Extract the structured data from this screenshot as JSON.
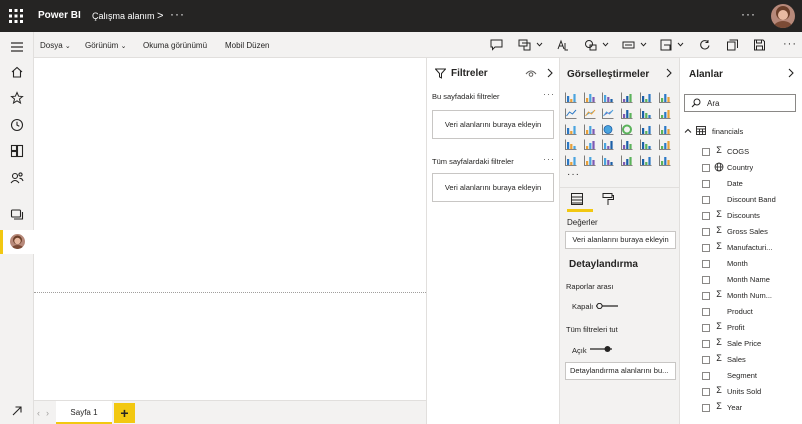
{
  "colors": {
    "topbar": "#252423",
    "accent_yellow": "#f2c811",
    "rail_bg": "#f3f2f1"
  },
  "topbar": {
    "app_name": "Power BI",
    "workspace": "Çalışma alanım",
    "chevron": ">",
    "more": "···",
    "right_more": "···"
  },
  "menu": {
    "items": [
      "Dosya",
      "Görünüm",
      "Okuma görünümü",
      "Mobil Düzen"
    ]
  },
  "toolbar": {
    "icons": [
      "comment-icon",
      "visual-interactions-icon",
      "text-box-icon",
      "shapes-icon",
      "buttons-icon",
      "image-icon",
      "refresh-icon",
      "duplicate-icon",
      "save-icon",
      "more-icon"
    ],
    "more": "···"
  },
  "filters": {
    "title": "Filtreler",
    "this_page_label": "Bu sayfadaki filtreler",
    "this_page_drop": "Veri alanlarını buraya ekleyin",
    "all_pages_label": "Tüm sayfalardaki filtreler",
    "all_pages_drop": "Veri alanlarını buraya ekleyin",
    "more": "···"
  },
  "visualizations": {
    "title": "Görselleştirmeler",
    "more": "···",
    "values_label": "Değerler",
    "values_drop": "Veri alanlarını buraya ekleyin",
    "drillthrough_title": "Detaylandırma",
    "cross_report_label": "Raporlar arası",
    "cross_report_state": "Kapalı",
    "cross_report_on": false,
    "keep_filters_label": "Tüm filtreleri tut",
    "keep_filters_state": "Açık",
    "keep_filters_on": true,
    "drillthrough_drop": "Detaylandırma alanlarını bu..."
  },
  "fields": {
    "title": "Alanlar",
    "search_placeholder": "Ara",
    "table_name": "financials",
    "items": [
      {
        "name": "COGS",
        "icon": "sigma"
      },
      {
        "name": "Country",
        "icon": "globe"
      },
      {
        "name": "Date",
        "icon": "none"
      },
      {
        "name": "Discount Band",
        "icon": "none"
      },
      {
        "name": "Discounts",
        "icon": "sigma"
      },
      {
        "name": "Gross Sales",
        "icon": "sigma"
      },
      {
        "name": "Manufacturi...",
        "icon": "sigma"
      },
      {
        "name": "Month",
        "icon": "none"
      },
      {
        "name": "Month Name",
        "icon": "none"
      },
      {
        "name": "Month Num...",
        "icon": "sigma"
      },
      {
        "name": "Product",
        "icon": "none"
      },
      {
        "name": "Profit",
        "icon": "sigma"
      },
      {
        "name": "Sale Price",
        "icon": "sigma"
      },
      {
        "name": "Sales",
        "icon": "sigma"
      },
      {
        "name": "Segment",
        "icon": "none"
      },
      {
        "name": "Units Sold",
        "icon": "sigma"
      },
      {
        "name": "Year",
        "icon": "sigma"
      }
    ]
  },
  "pages": {
    "tabs": [
      "Sayfa 1"
    ],
    "add_label": "+"
  }
}
